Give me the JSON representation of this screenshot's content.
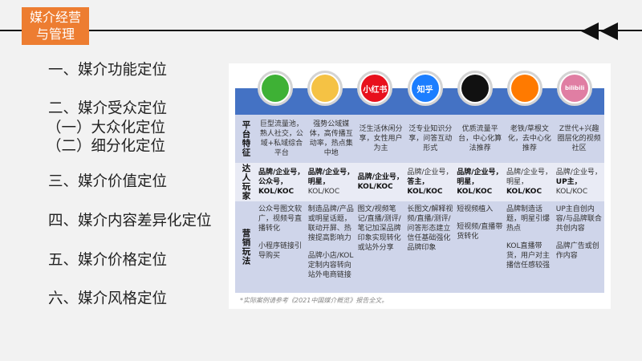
{
  "header": {
    "title_line1": "媒介经营",
    "title_line2": "与管理"
  },
  "outline": [
    "一、媒介功能定位",
    "二、媒介受众定位",
    "（一）大众化定位",
    "（二）细分化定位",
    "三、媒介价值定位",
    "四、媒介内容差异化定位",
    "五、媒介价格定位",
    "六、媒介风格定位"
  ],
  "table": {
    "platforms": [
      {
        "icon": "wechat-icon",
        "label": "",
        "color": "#3eb135"
      },
      {
        "icon": "weibo-icon",
        "label": "",
        "color": "#f5c244"
      },
      {
        "icon": "xiaohongshu-icon",
        "label": "小红书",
        "color": "#e8101c"
      },
      {
        "icon": "zhihu-icon",
        "label": "知乎",
        "color": "#1c7eff"
      },
      {
        "icon": "douyin-icon",
        "label": "",
        "color": "#111111"
      },
      {
        "icon": "kuaishou-icon",
        "label": "",
        "color": "#ff7a00"
      },
      {
        "icon": "bilibili-icon",
        "label": "bilibili",
        "color": "#e07ea3"
      }
    ],
    "row_labels": [
      "平台特征",
      "达人玩家",
      "营销玩法"
    ],
    "features": [
      "巨型流量池，熟人社交，公域+私域综合平台",
      "强势公域媒体，高传播互动率，热点集中地",
      "泛生活休闲分享，女性用户为主",
      "泛专业知识分享，问答互动形式",
      "优质流量平台，中心化算法推荐",
      "老铁/草根文化，去中心化推荐",
      "Z世代+兴趣圈层化的视频社区"
    ],
    "talents": [
      [
        {
          "t": "品牌/企业号，",
          "b": true
        },
        {
          "t": "公众号，",
          "b": true
        },
        {
          "t": "KOL/KOC",
          "b": true
        }
      ],
      [
        {
          "t": "品牌/企业号，",
          "b": true
        },
        {
          "t": "明星，",
          "b": true
        },
        {
          "t": "KOL/KOC",
          "b": false
        }
      ],
      [
        {
          "t": "品牌/企业号，",
          "b": true
        },
        {
          "t": "KOL/KOC",
          "b": true
        }
      ],
      [
        {
          "t": "品牌/企业号，",
          "b": false
        },
        {
          "t": "答主，",
          "b": true
        },
        {
          "t": "KOL/KOC",
          "b": true
        }
      ],
      [
        {
          "t": "品牌/企业号，",
          "b": true
        },
        {
          "t": "明星，",
          "b": true
        },
        {
          "t": "KOL/KOC",
          "b": true
        }
      ],
      [
        {
          "t": "品牌/企业号，",
          "b": false
        },
        {
          "t": "明星，",
          "b": false
        },
        {
          "t": "KOL/KOC",
          "b": true
        }
      ],
      [
        {
          "t": "品牌/企业号，",
          "b": false
        },
        {
          "t": "UP主，",
          "b": true
        },
        {
          "t": "KOL/KOC",
          "b": false
        }
      ]
    ],
    "marketing": [
      [
        "公众号图文软广，视频号直播转化",
        "小程序链接引导购买"
      ],
      [
        "制造品牌/产品或明星话题，联动开屏、热搜提高影响力",
        "品牌小店/KOL定制内容转向站外电商链接"
      ],
      [
        "图文/视频笔记/直播/测评/笔记加深品牌印象实现转化或站外分享"
      ],
      [
        "长图文/解释视频/直播/测评/问答形态建立信任基础强化品牌印象"
      ],
      [
        "短视频植入",
        "短视频/直播带货转化"
      ],
      [
        "品牌制造话题，明星引爆热点",
        "KOL直播带货，用户对主播信任感较强"
      ],
      [
        "UP主自创内容/与品牌联合共创内容",
        "品牌广告或创作内容"
      ]
    ],
    "note": "*实际案例请参考《2021中国媒介概览》报告全文。"
  }
}
